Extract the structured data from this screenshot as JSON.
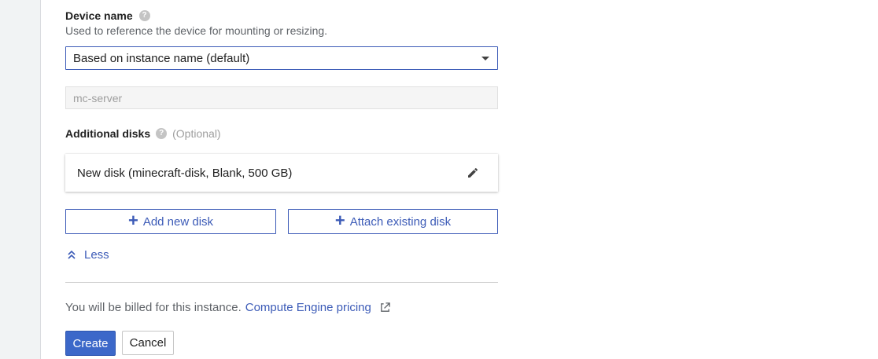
{
  "device_name": {
    "label": "Device name",
    "help_glyph": "?",
    "hint": "Used to reference the device for mounting or resizing.",
    "select_value": "Based on instance name (default)",
    "input_value": "mc-server"
  },
  "additional_disks": {
    "label": "Additional disks",
    "help_glyph": "?",
    "optional": "(Optional)",
    "disks": [
      {
        "label": "New disk (minecraft-disk, Blank, 500 GB)"
      }
    ],
    "add_new_label": "Add new disk",
    "attach_existing_label": "Attach existing disk",
    "plus_glyph": "+"
  },
  "less_label": "Less",
  "billing": {
    "text": "You will be billed for this instance.",
    "link": "Compute Engine pricing"
  },
  "actions": {
    "create": "Create",
    "cancel": "Cancel"
  },
  "colors": {
    "accent": "#3c5bb7",
    "primary_button": "#3c68c9"
  },
  "icons": [
    "help-icon",
    "dropdown-caret-icon",
    "edit-pencil-icon",
    "plus-icon",
    "double-chevron-up-icon",
    "external-link-icon"
  ]
}
